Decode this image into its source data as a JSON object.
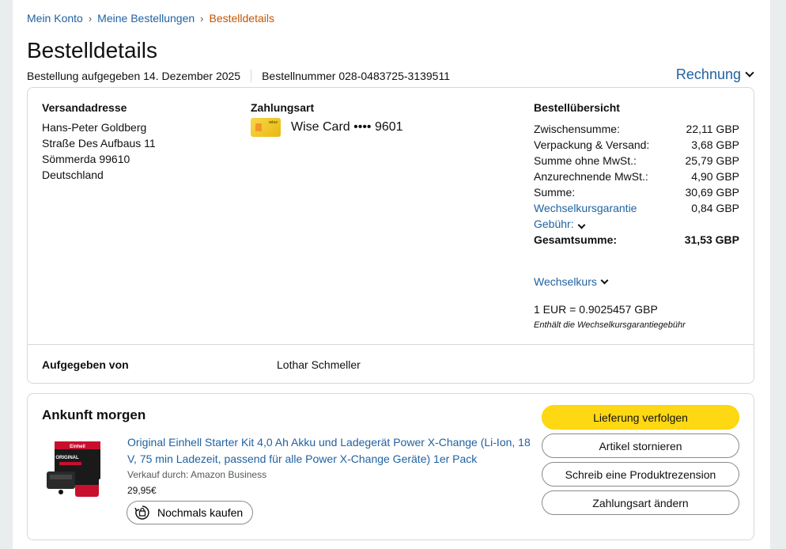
{
  "breadcrumb": {
    "items": [
      "Mein Konto",
      "Meine Bestellungen"
    ],
    "separator": "›",
    "current": "Bestelldetails"
  },
  "title": "Bestelldetails",
  "meta": {
    "order_date": "Bestellung aufgegeben 14. Dezember 2025",
    "order_number": "Bestellnummer 028-0483725-3139511"
  },
  "invoice_label": "Rechnung",
  "shipping": {
    "heading": "Versandadresse",
    "lines": [
      "Hans-Peter Goldberg",
      "Straße Des Aufbaus 11",
      "Sömmerda 99610",
      "Deutschland"
    ]
  },
  "payment": {
    "heading": "Zahlungsart",
    "card_label": "Wise Card •••• 9601",
    "card_brand": "wise"
  },
  "summary": {
    "heading": "Bestellübersicht",
    "rows": [
      {
        "label": "Zwischensumme:",
        "value": "22,11 GBP"
      },
      {
        "label": "Verpackung & Versand:",
        "value": "3,68 GBP"
      },
      {
        "label": "Summe ohne MwSt.:",
        "value": "25,79 GBP"
      },
      {
        "label": "Anzurechnende MwSt.:",
        "value": "4,90 GBP"
      },
      {
        "label": "Summe:",
        "value": "30,69 GBP"
      }
    ],
    "fee_label_line1": "Wechselkursgarantie",
    "fee_label_line2": "Gebühr:",
    "fee_value": "0,84 GBP",
    "total_label": "Gesamtsumme:",
    "total_value": "31,53 GBP",
    "fx_toggle": "Wechselkurs",
    "fx_rate": "1 EUR = 0.9025457 GBP",
    "fx_note": "Enthält die Wechselkursgarantiegebühr"
  },
  "placed_by": {
    "label": "Aufgegeben von",
    "value": "Lothar Schmeller"
  },
  "shipment": {
    "arrival": "Ankunft morgen",
    "product_title": "Original Einhell Starter Kit 4,0 Ah Akku und Ladegerät Power X-Change (Li-Ion, 18 V, 75 min Ladezeit, passend für alle Power X-Change Geräte) 1er Pack",
    "seller": "Verkauf durch: Amazon Business",
    "price": "29,95€",
    "rebuy_label": "Nochmals kaufen",
    "thumb_brand": "Einhell",
    "thumb_text": "ORIGINAL"
  },
  "actions": {
    "track": "Lieferung verfolgen",
    "cancel": "Artikel stornieren",
    "review": "Schreib eine Produktrezension",
    "change_payment": "Zahlungsart ändern"
  },
  "colors": {
    "link": "#2162a1",
    "breadcrumb_current": "#c45500",
    "primary_button": "#ffd814",
    "card": "#f5c518"
  }
}
